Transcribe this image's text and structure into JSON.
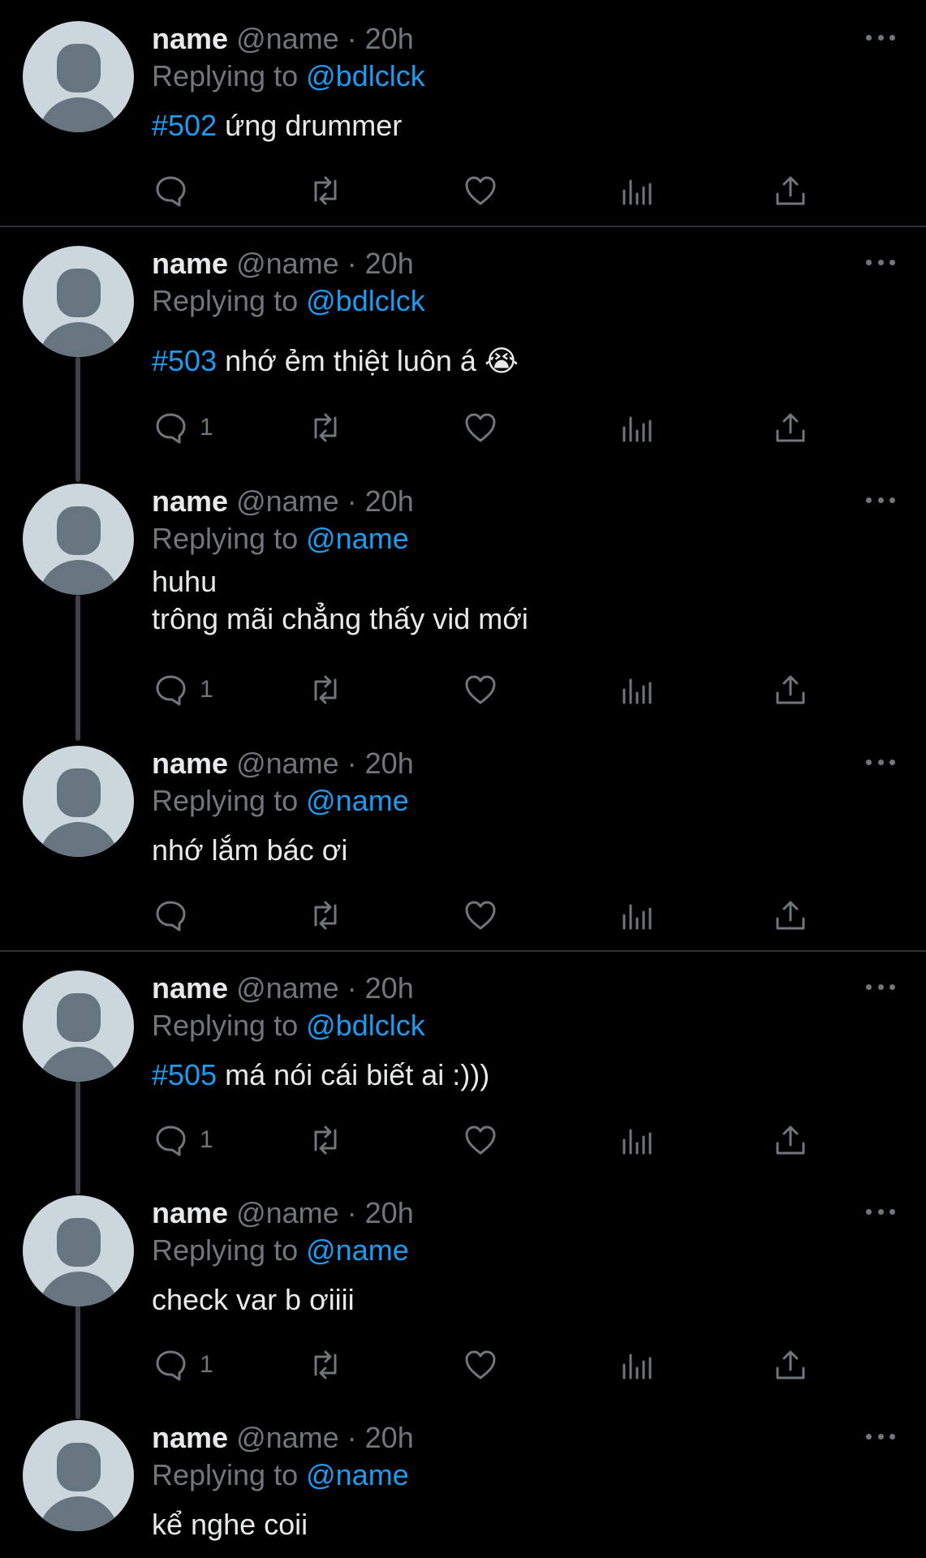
{
  "tweets": [
    {
      "name": "name",
      "handle": "@name · 20h",
      "replying_prefix": "Replying to",
      "replying_to": "@bdlclck",
      "tag": "#502",
      "text": [
        "ứng drummer"
      ],
      "reply_count": ""
    },
    {
      "name": "name",
      "handle": "@name · 20h",
      "replying_prefix": "Replying to",
      "replying_to": "@bdlclck",
      "tag": "#503",
      "text": [
        "nhớ ẻm thiệt luôn á 😭"
      ],
      "reply_count": "1"
    },
    {
      "name": "name",
      "handle": "@name · 20h",
      "replying_prefix": "Replying to",
      "replying_to": "@name",
      "tag": "",
      "text": [
        "huhu",
        "trông mãi chẳng thấy vid mới"
      ],
      "reply_count": "1"
    },
    {
      "name": "name",
      "handle": "@name · 20h",
      "replying_prefix": "Replying to",
      "replying_to": "@name",
      "tag": "",
      "text": [
        "nhớ lắm bác ơi"
      ],
      "reply_count": ""
    },
    {
      "name": "name",
      "handle": "@name · 20h",
      "replying_prefix": "Replying to",
      "replying_to": "@bdlclck",
      "tag": "#505",
      "text": [
        "má nói cái biết ai :)))"
      ],
      "reply_count": "1"
    },
    {
      "name": "name",
      "handle": "@name · 20h",
      "replying_prefix": "Replying to",
      "replying_to": "@name",
      "tag": "",
      "text": [
        "check var b ơiiii"
      ],
      "reply_count": "1"
    },
    {
      "name": "name",
      "handle": "@name · 20h",
      "replying_prefix": "Replying to",
      "replying_to": "@name",
      "tag": "",
      "text": [
        "kể nghe coii"
      ],
      "reply_count": ""
    }
  ],
  "icons": {
    "avatar": "default-avatar-icon",
    "more": "more-options-icon",
    "reply": "reply-icon",
    "retweet": "retweet-icon",
    "like": "like-icon",
    "views": "views-icon",
    "share": "share-icon"
  },
  "colors": {
    "background": "#000000",
    "link": "#1d9bf0",
    "muted": "#71767b",
    "avatar_bg": "#ccd6dd",
    "avatar_fg": "#66757f"
  }
}
